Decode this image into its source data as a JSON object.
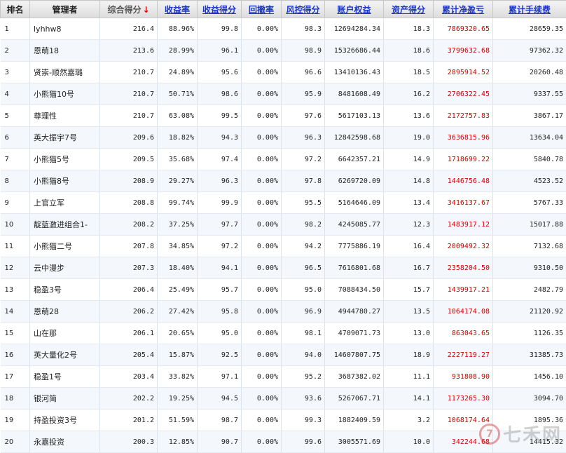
{
  "headers": {
    "rank": "排名",
    "manager": "管理者",
    "composite": "综合得分",
    "return_rate": "收益率",
    "return_score": "收益得分",
    "drawdown": "回撤率",
    "risk_score": "风控得分",
    "equity": "账户权益",
    "asset_score": "资产得分",
    "net_pl": "累计净盈亏",
    "fees": "累计手续费"
  },
  "sort_arrow": "↓",
  "rows": [
    [
      "1",
      "lyhhw8",
      "216.4",
      "88.96%",
      "99.8",
      "0.00%",
      "98.3",
      "12694284.34",
      "18.3",
      "7869320.65",
      "28659.35"
    ],
    [
      "2",
      "恩萌18",
      "213.6",
      "28.99%",
      "96.1",
      "0.00%",
      "98.9",
      "15326686.44",
      "18.6",
      "3799632.68",
      "97362.32"
    ],
    [
      "3",
      "贤崇-顺然嘉璐",
      "210.7",
      "24.89%",
      "95.6",
      "0.00%",
      "96.6",
      "13410136.43",
      "18.5",
      "2895914.52",
      "20260.48"
    ],
    [
      "4",
      "小熊猫10号",
      "210.7",
      "50.71%",
      "98.6",
      "0.00%",
      "95.9",
      "8481608.49",
      "16.2",
      "2706322.45",
      "9337.55"
    ],
    [
      "5",
      "尊理性",
      "210.7",
      "63.08%",
      "99.5",
      "0.00%",
      "97.6",
      "5617103.13",
      "13.6",
      "2172757.83",
      "3867.17"
    ],
    [
      "6",
      "英大振宇7号",
      "209.6",
      "18.82%",
      "94.3",
      "0.00%",
      "96.3",
      "12842598.68",
      "19.0",
      "3636815.96",
      "13634.04"
    ],
    [
      "7",
      "小熊猫5号",
      "209.5",
      "35.68%",
      "97.4",
      "0.00%",
      "97.2",
      "6642357.21",
      "14.9",
      "1718699.22",
      "5840.78"
    ],
    [
      "8",
      "小熊猫8号",
      "208.9",
      "29.27%",
      "96.3",
      "0.00%",
      "97.8",
      "6269720.09",
      "14.8",
      "1446756.48",
      "4523.52"
    ],
    [
      "9",
      "上官立军",
      "208.8",
      "99.74%",
      "99.9",
      "0.00%",
      "95.5",
      "5164646.09",
      "13.4",
      "3416137.67",
      "5767.33"
    ],
    [
      "10",
      "靛蓝激进组合1-",
      "208.2",
      "37.25%",
      "97.7",
      "0.00%",
      "98.2",
      "4245085.77",
      "12.3",
      "1483917.12",
      "15017.88"
    ],
    [
      "11",
      "小熊猫二号",
      "207.8",
      "34.85%",
      "97.2",
      "0.00%",
      "94.2",
      "7775886.19",
      "16.4",
      "2009492.32",
      "7132.68"
    ],
    [
      "12",
      "云中漫步",
      "207.3",
      "18.40%",
      "94.1",
      "0.00%",
      "96.5",
      "7616801.68",
      "16.7",
      "2358204.50",
      "9310.50"
    ],
    [
      "13",
      "稳盈3号",
      "206.4",
      "25.49%",
      "95.7",
      "0.00%",
      "95.0",
      "7088434.50",
      "15.7",
      "1439917.21",
      "2482.79"
    ],
    [
      "14",
      "恩萌28",
      "206.2",
      "27.42%",
      "95.8",
      "0.00%",
      "96.9",
      "4944780.27",
      "13.5",
      "1064174.08",
      "21120.92"
    ],
    [
      "15",
      "山在那",
      "206.1",
      "20.65%",
      "95.0",
      "0.00%",
      "98.1",
      "4709071.73",
      "13.0",
      "863043.65",
      "1126.35"
    ],
    [
      "16",
      "英大量化2号",
      "205.4",
      "15.87%",
      "92.5",
      "0.00%",
      "94.0",
      "14607807.75",
      "18.9",
      "2227119.27",
      "31385.73"
    ],
    [
      "17",
      "稳盈1号",
      "203.4",
      "33.82%",
      "97.1",
      "0.00%",
      "95.2",
      "3687382.02",
      "11.1",
      "931808.90",
      "1456.10"
    ],
    [
      "18",
      "银河简",
      "202.2",
      "19.25%",
      "94.5",
      "0.00%",
      "93.6",
      "5267067.71",
      "14.1",
      "1173265.30",
      "3094.70"
    ],
    [
      "19",
      "持盈投资3号",
      "201.2",
      "51.59%",
      "98.7",
      "0.00%",
      "99.3",
      "1882409.59",
      "3.2",
      "1068174.64",
      "1895.36"
    ],
    [
      "20",
      "永嘉投资",
      "200.3",
      "12.85%",
      "90.7",
      "0.00%",
      "99.6",
      "3005571.69",
      "10.0",
      "342244.68",
      "14415.32"
    ]
  ],
  "watermark": "七禾网",
  "accent_red": "#d30000",
  "link_blue": "#1a35c8"
}
